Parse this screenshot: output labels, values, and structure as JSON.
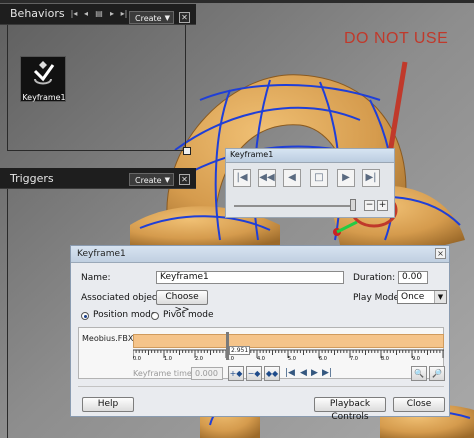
{
  "behaviors": {
    "title": "Behaviors",
    "create_label": "Create",
    "node_label": "Keyframe1",
    "toolbar_icons": [
      "first-icon",
      "prev-icon",
      "list-icon",
      "next-icon",
      "last-icon"
    ]
  },
  "triggers": {
    "title": "Triggers",
    "create_label": "Create"
  },
  "annotation": {
    "text": "DO NOT USE",
    "color": "#c0392b"
  },
  "small_window": {
    "title": "Keyframe1",
    "buttons": [
      "first-frame-icon",
      "rewind-icon",
      "play-reverse-icon",
      "stop-icon",
      "play-icon",
      "last-frame-icon"
    ],
    "zoom_out": "−",
    "zoom_in": "+"
  },
  "dialog": {
    "title": "Keyframe1",
    "close": "×",
    "name_label": "Name:",
    "name_value": "Keyframe1",
    "duration_label": "Duration:",
    "duration_value": "0.00",
    "assoc_label": "Associated objects:",
    "choose_label": "Choose >>",
    "play_mode_label": "Play Mode:",
    "play_mode_value": "Once",
    "position_mode": "Position mode",
    "pivot_mode": "Pivot mode",
    "track_label": "Meobius.FBX",
    "playhead_value": "2.951",
    "ruler_ticks": [
      "0.0",
      "1.0",
      "2.0",
      "3.0",
      "4.0",
      "5.0",
      "6.0",
      "7.0",
      "8.0",
      "9.0"
    ],
    "kf_time_label": "Keyframe time:",
    "kf_time_value": "0.000",
    "help_label": "Help",
    "playback_label": "Playback Controls",
    "close_label": "Close"
  },
  "colors": {
    "accent_track": "#f5c48a",
    "panel_dark": "#1e1e1e",
    "mesh": "#d8a65a",
    "wire": "#1f3fd8"
  }
}
